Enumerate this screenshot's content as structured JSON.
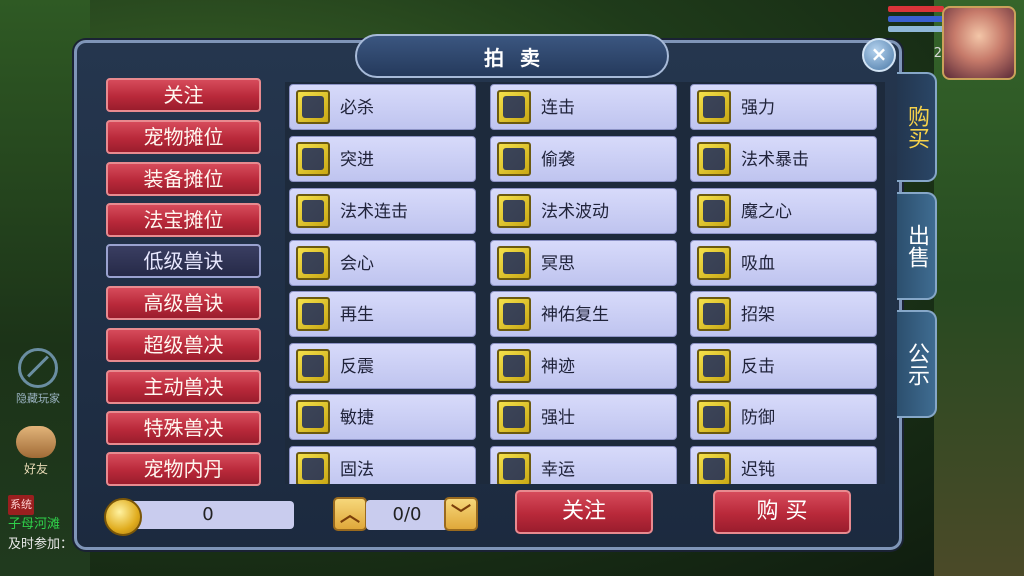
{
  "title": "拍卖",
  "close_label": "×",
  "hud": {
    "count": "2"
  },
  "left_hud": {
    "hide_players": "隐藏玩家",
    "friends": "好友"
  },
  "chat": {
    "tag": "系统",
    "line1": "子母河滩",
    "line2": "及时参加："
  },
  "categories": [
    "关注",
    "宠物摊位",
    "装备摊位",
    "法宝摊位",
    "低级兽诀",
    "高级兽诀",
    "超级兽决",
    "主动兽决",
    "特殊兽决",
    "宠物内丹"
  ],
  "active_category": "低级兽诀",
  "skills": [
    [
      "必杀",
      "连击",
      "强力"
    ],
    [
      "突进",
      "偷袭",
      "法术暴击"
    ],
    [
      "法术连击",
      "法术波动",
      "魔之心"
    ],
    [
      "会心",
      "冥思",
      "吸血"
    ],
    [
      "再生",
      "神佑复生",
      "招架"
    ],
    [
      "反震",
      "神迹",
      "反击"
    ],
    [
      "敏捷",
      "强壮",
      "防御"
    ],
    [
      "固法",
      "幸运",
      "迟钝"
    ]
  ],
  "tabs": [
    "购买",
    "出售",
    "公示"
  ],
  "active_tab": "购买",
  "bottom": {
    "money": "0",
    "page": "0/0",
    "prev_icon": "arrow-up-icon",
    "next_icon": "arrow-down-icon",
    "follow_label": "关注",
    "buy_label": "购 买"
  },
  "colors": {
    "button_red": "#b9293a",
    "panel_bg": "#1c2a3f",
    "skill_cell": "#c9ccee",
    "active_tab_text": "#f6d24a"
  }
}
